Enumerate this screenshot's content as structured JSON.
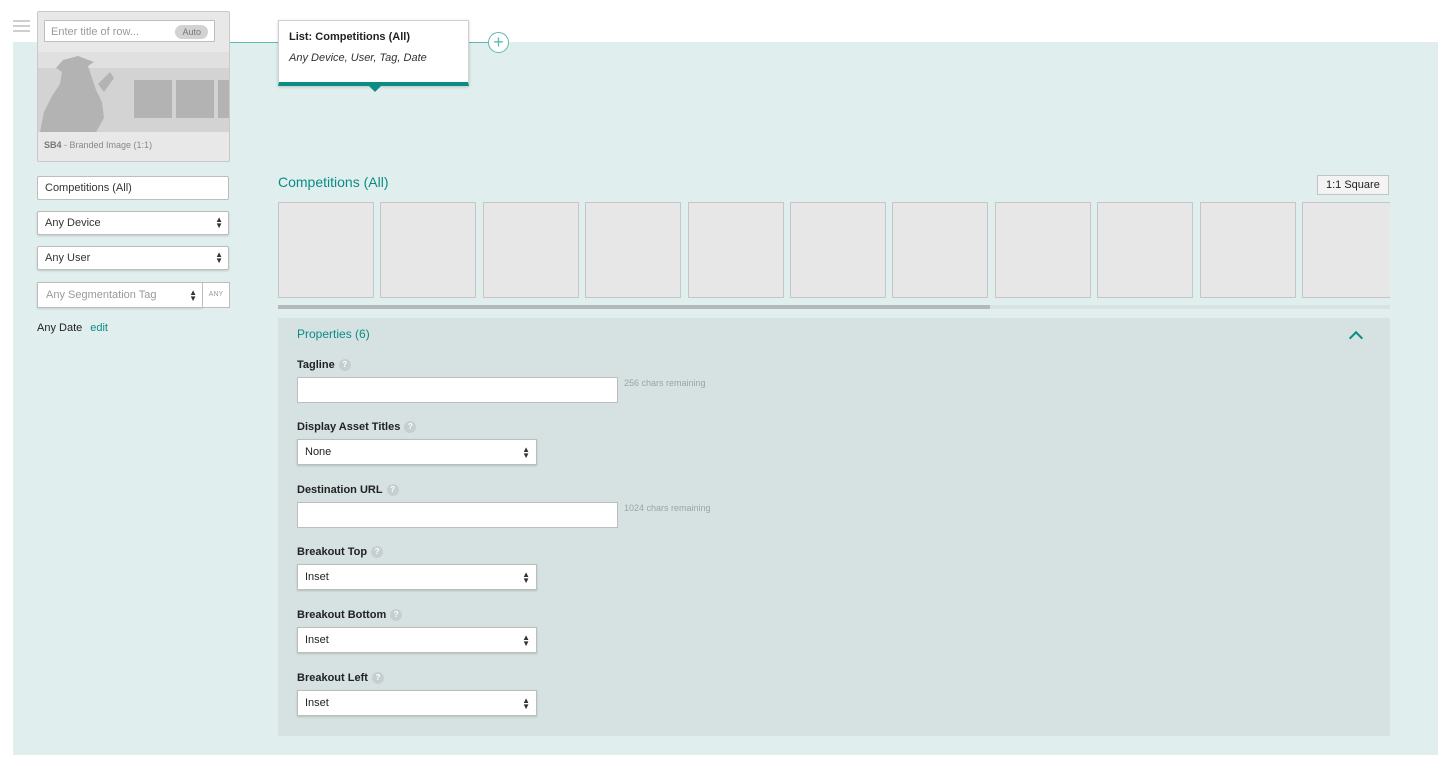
{
  "row_card": {
    "title_placeholder": "Enter title of row...",
    "auto_label": "Auto",
    "caption_code": "SB4",
    "caption_text": " - Branded Image (1:1)"
  },
  "filters": {
    "list_name": "Competitions (All)",
    "device": "Any Device",
    "user": "Any User",
    "segmentation_placeholder": "Any Segmentation Tag",
    "segmentation_any": "ANY",
    "date_label": "Any Date",
    "date_edit": "edit"
  },
  "tooltip": {
    "title": "List: Competitions (All)",
    "subtitle": "Any Device, User, Tag, Date"
  },
  "row": {
    "title": "Competitions (All)",
    "aspect_button": "1:1 Square",
    "scroll_fraction": 0.64
  },
  "properties": {
    "header": "Properties (6)",
    "tagline_label": "Tagline",
    "tagline_chars": "256 chars remaining",
    "display_titles_label": "Display Asset Titles",
    "display_titles_value": "None",
    "destination_url_label": "Destination URL",
    "destination_url_chars": "1024 chars remaining",
    "breakout_top_label": "Breakout Top",
    "breakout_top_value": "Inset",
    "breakout_bottom_label": "Breakout Bottom",
    "breakout_bottom_value": "Inset",
    "breakout_left_label": "Breakout Left",
    "breakout_left_value": "Inset",
    "help_glyph": "?"
  },
  "colors": {
    "accent": "#0a8c84",
    "panel_bg": "#e1eeee",
    "properties_bg": "#d5e2e1"
  },
  "icons": {
    "menu": "hamburger-icon",
    "add": "plus-circle-icon",
    "collapse": "chevron-up-icon",
    "select_arrows": "updown-arrows-icon"
  }
}
